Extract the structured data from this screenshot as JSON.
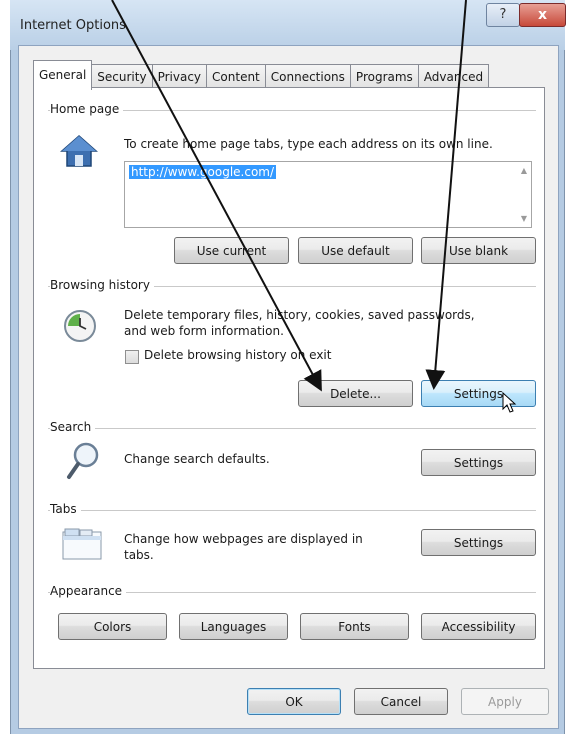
{
  "window": {
    "title": "Internet Options",
    "help_glyph": "?",
    "close_glyph": "x"
  },
  "tabs": [
    {
      "label": "General",
      "active": true
    },
    {
      "label": "Security",
      "active": false
    },
    {
      "label": "Privacy",
      "active": false
    },
    {
      "label": "Content",
      "active": false
    },
    {
      "label": "Connections",
      "active": false
    },
    {
      "label": "Programs",
      "active": false
    },
    {
      "label": "Advanced",
      "active": false
    }
  ],
  "home_page": {
    "title": "Home page",
    "description": "To create home page tabs, type each address on its own line.",
    "url": "http://www.google.com/",
    "buttons": {
      "use_current": "Use current",
      "use_default": "Use default",
      "use_blank": "Use blank"
    }
  },
  "browsing_history": {
    "title": "Browsing history",
    "description_line1": "Delete temporary files, history, cookies, saved passwords,",
    "description_line2": "and web form information.",
    "checkbox_label": "Delete browsing history on exit",
    "checkbox_checked": false,
    "delete_button": "Delete...",
    "settings_button": "Settings"
  },
  "search": {
    "title": "Search",
    "description": "Change search defaults.",
    "settings_button": "Settings"
  },
  "tabs_section": {
    "title": "Tabs",
    "description_line1": "Change how webpages are displayed in",
    "description_line2": "tabs.",
    "settings_button": "Settings"
  },
  "appearance": {
    "title": "Appearance",
    "buttons": {
      "colors": "Colors",
      "languages": "Languages",
      "fonts": "Fonts",
      "accessibility": "Accessibility"
    }
  },
  "footer": {
    "ok": "OK",
    "cancel": "Cancel",
    "apply": "Apply"
  },
  "colors": {
    "selection": "#3399ff",
    "hover_button": "#bee6fd",
    "close_button": "#c7493a",
    "title_bar": "#b9cfe6"
  }
}
